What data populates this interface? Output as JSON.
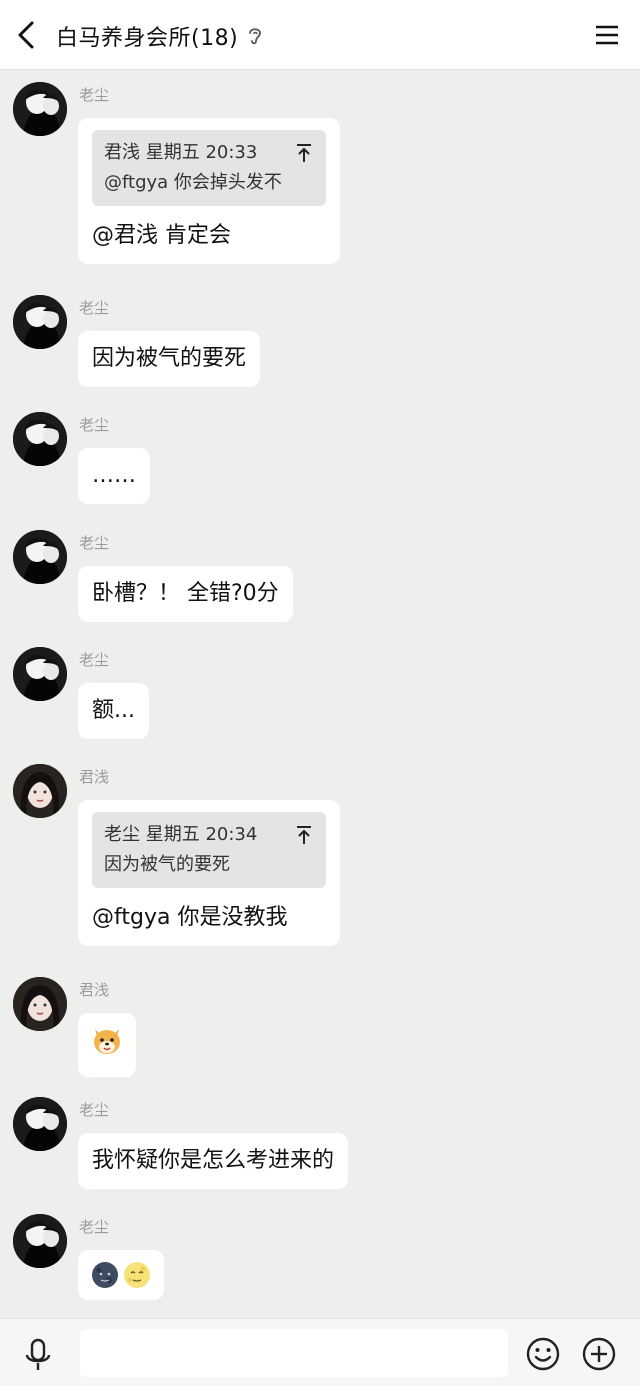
{
  "header": {
    "title": "白马养身会所(18)"
  },
  "messages": [
    {
      "sender": "老尘",
      "avatar": "manga-avatar",
      "quote": {
        "head": "君浅 星期五 20:33",
        "text": "@ftgya 你会掉头发不"
      },
      "text": "@君浅 肯定会"
    },
    {
      "sender": "老尘",
      "avatar": "manga-avatar",
      "text": "因为被气的要死"
    },
    {
      "sender": "老尘",
      "avatar": "manga-avatar",
      "text": "……"
    },
    {
      "sender": "老尘",
      "avatar": "manga-avatar",
      "text": "卧槽？！ 全错?0分"
    },
    {
      "sender": "老尘",
      "avatar": "manga-avatar",
      "text": "额..."
    },
    {
      "sender": "君浅",
      "avatar": "girl-avatar",
      "quote": {
        "head": "老尘 星期五 20:34",
        "text": "因为被气的要死"
      },
      "text": "@ftgya 你是没教我"
    },
    {
      "sender": "君浅",
      "avatar": "girl-avatar",
      "emojis": [
        "dog-face-emoji"
      ]
    },
    {
      "sender": "老尘",
      "avatar": "manga-avatar",
      "text": "我怀疑你是怎么考进来的"
    },
    {
      "sender": "老尘",
      "avatar": "manga-avatar",
      "emojis": [
        "new-moon-face-emoji",
        "full-moon-face-emoji"
      ]
    }
  ],
  "input": {
    "value": "",
    "placeholder": ""
  },
  "colors": {
    "background": "#ecefec",
    "bubble": "#ffffff",
    "quote_bg": "#e4e4e4",
    "sender_name": "#9b9b9b"
  }
}
